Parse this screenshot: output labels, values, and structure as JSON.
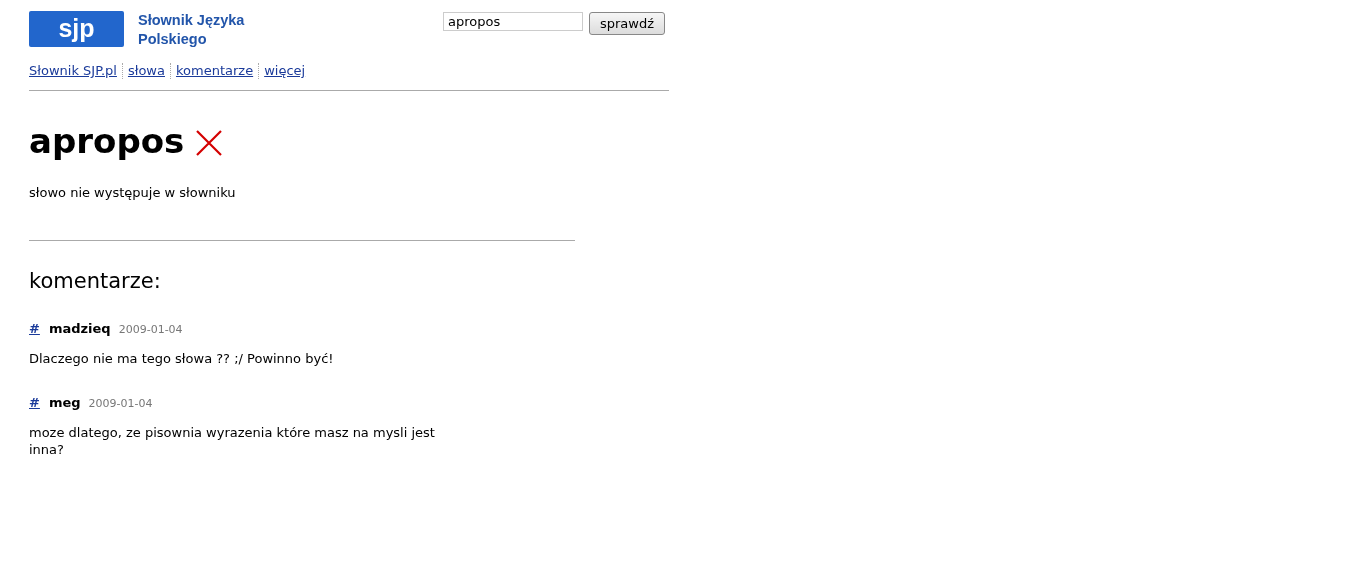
{
  "logo": "sjp",
  "site_title": "Słownik Języka Polskiego",
  "search": {
    "value": "apropos",
    "button": "sprawdź"
  },
  "nav": [
    "Słownik SJP.pl",
    "słowa",
    "komentarze",
    "więcej"
  ],
  "entry": {
    "word": "apropos",
    "found": false,
    "message": "słowo nie występuje w słowniku"
  },
  "comments_heading": "komentarze:",
  "comments": [
    {
      "anchor": "#",
      "author": "madzieq",
      "date": "2009-01-04",
      "text": "Dlaczego nie ma tego słowa ?? ;/ Powinno być!"
    },
    {
      "anchor": "#",
      "author": "meg",
      "date": "2009-01-04",
      "text": "moze dlatego, ze pisownia wyrazenia które masz na mysli jest inna?"
    }
  ]
}
